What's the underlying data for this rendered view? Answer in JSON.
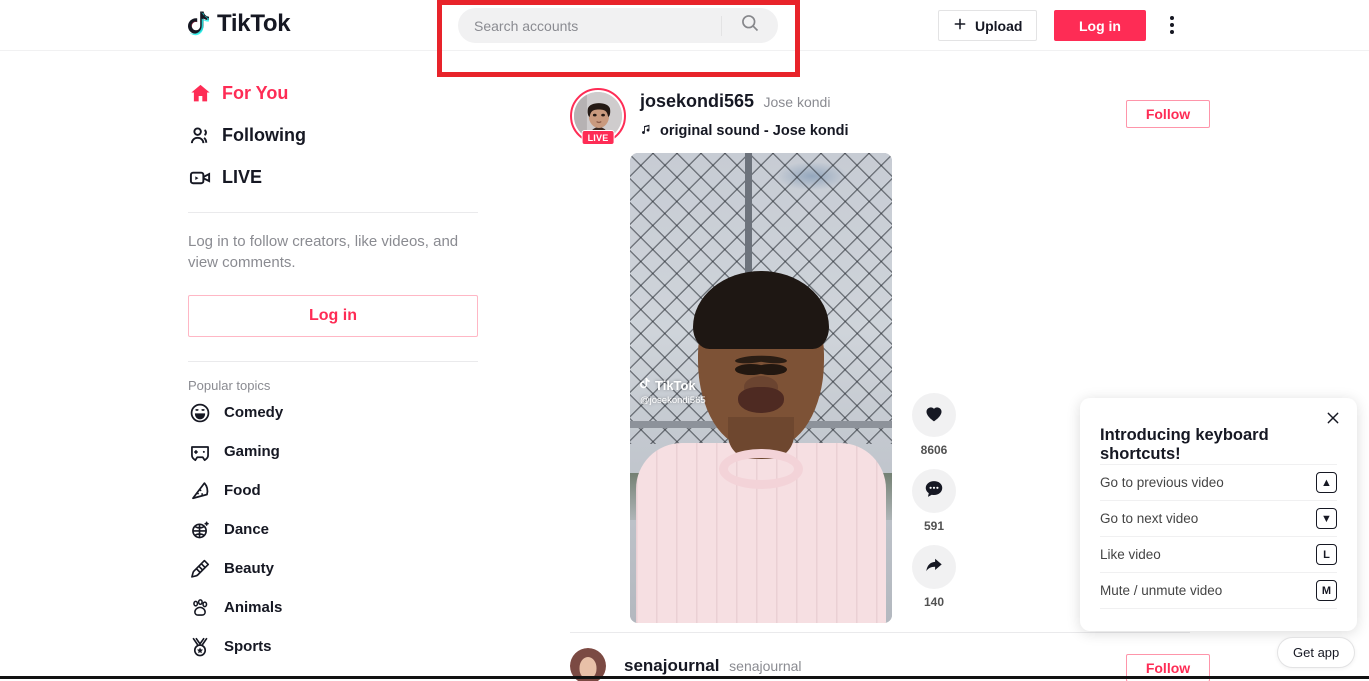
{
  "header": {
    "logo_text": "TikTok",
    "logo_icon": "tiktok-note-icon",
    "search": {
      "placeholder": "Search accounts",
      "value": "",
      "icon": "search-icon"
    },
    "upload_label": "Upload",
    "upload_icon": "plus-icon",
    "login_label": "Log in",
    "more_icon": "kebab-menu-icon"
  },
  "annotation": {
    "color": "#e8232a",
    "target": "search-box"
  },
  "sidebar": {
    "nav": [
      {
        "label": "For You",
        "icon": "home-icon",
        "active": true
      },
      {
        "label": "Following",
        "icon": "people-icon",
        "active": false
      },
      {
        "label": "LIVE",
        "icon": "live-video-icon",
        "active": false
      }
    ],
    "login_note": "Log in to follow creators, like videos, and view comments.",
    "login_label": "Log in",
    "topics_title": "Popular topics",
    "topics": [
      {
        "label": "Comedy",
        "icon": "laugh-face-icon"
      },
      {
        "label": "Gaming",
        "icon": "gamepad-icon"
      },
      {
        "label": "Food",
        "icon": "pizza-slice-icon"
      },
      {
        "label": "Dance",
        "icon": "disco-ball-icon"
      },
      {
        "label": "Beauty",
        "icon": "makeup-brush-icon"
      },
      {
        "label": "Animals",
        "icon": "paw-print-icon"
      },
      {
        "label": "Sports",
        "icon": "medal-icon"
      }
    ]
  },
  "feed": {
    "posts": [
      {
        "username": "josekondi565",
        "nickname": "Jose kondi",
        "live_badge": "LIVE",
        "music_icon": "music-note-icon",
        "music": "original sound - Jose kondi",
        "follow_label": "Follow",
        "video_watermark_brand": "TikTok",
        "video_watermark_user": "@josekondi565",
        "actions": [
          {
            "icon": "heart-icon",
            "count": "8606"
          },
          {
            "icon": "comment-icon",
            "count": "591"
          },
          {
            "icon": "share-icon",
            "count": "140"
          }
        ]
      },
      {
        "username": "senajournal",
        "nickname": "senajournal",
        "follow_label": "Follow"
      }
    ]
  },
  "popup": {
    "close_icon": "close-icon",
    "title": "Introducing keyboard shortcuts!",
    "shortcuts": [
      {
        "label": "Go to previous video",
        "key": "▲"
      },
      {
        "label": "Go to next video",
        "key": "▼"
      },
      {
        "label": "Like video",
        "key": "L"
      },
      {
        "label": "Mute / unmute video",
        "key": "M"
      }
    ]
  },
  "get_app_label": "Get app"
}
